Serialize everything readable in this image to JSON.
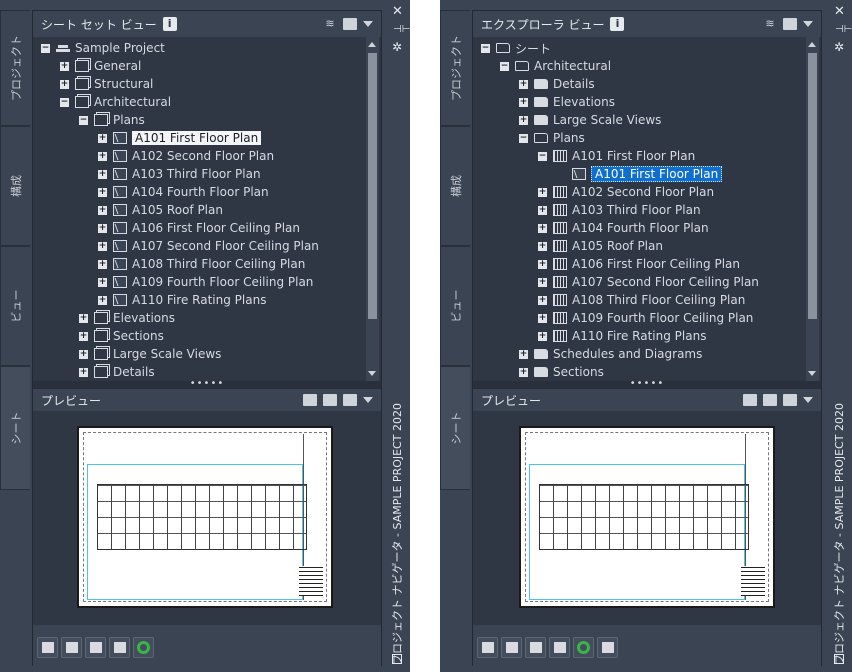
{
  "left": {
    "title": "シート セット ビュー",
    "info": "i",
    "tabs": [
      "プロジェクト",
      "構成",
      "ビュー",
      "シート"
    ],
    "tree": [
      {
        "label": "Sample Project",
        "exp": "−",
        "icon": "root",
        "lvl": 0
      },
      {
        "label": "General",
        "exp": "+",
        "icon": "stack",
        "lvl": 1
      },
      {
        "label": "Structural",
        "exp": "+",
        "icon": "stack",
        "lvl": 1
      },
      {
        "label": "Architectural",
        "exp": "−",
        "icon": "stack",
        "lvl": 1
      },
      {
        "label": "Plans",
        "exp": "−",
        "icon": "stack",
        "lvl": 2
      },
      {
        "label": "A101 First Floor Plan",
        "exp": "+",
        "icon": "sheet",
        "lvl": 3,
        "sel": "outline"
      },
      {
        "label": "A102 Second Floor Plan",
        "exp": "+",
        "icon": "sheet",
        "lvl": 3
      },
      {
        "label": "A103 Third Floor Plan",
        "exp": "+",
        "icon": "sheet",
        "lvl": 3
      },
      {
        "label": "A104 Fourth Floor Plan",
        "exp": "+",
        "icon": "sheet",
        "lvl": 3
      },
      {
        "label": "A105 Roof Plan",
        "exp": "+",
        "icon": "sheet",
        "lvl": 3
      },
      {
        "label": "A106 First Floor Ceiling Plan",
        "exp": "+",
        "icon": "sheet",
        "lvl": 3
      },
      {
        "label": "A107 Second Floor Ceiling Plan",
        "exp": "+",
        "icon": "sheet",
        "lvl": 3
      },
      {
        "label": "A108 Third Floor Ceiling Plan",
        "exp": "+",
        "icon": "sheet",
        "lvl": 3
      },
      {
        "label": "A109 Fourth Floor Ceiling Plan",
        "exp": "+",
        "icon": "sheet",
        "lvl": 3
      },
      {
        "label": "A110 Fire Rating Plans",
        "exp": "+",
        "icon": "sheet",
        "lvl": 3
      },
      {
        "label": "Elevations",
        "exp": "+",
        "icon": "stack",
        "lvl": 2
      },
      {
        "label": "Sections",
        "exp": "+",
        "icon": "stack",
        "lvl": 2
      },
      {
        "label": "Large Scale Views",
        "exp": "+",
        "icon": "stack",
        "lvl": 2
      },
      {
        "label": "Details",
        "exp": "+",
        "icon": "stack",
        "lvl": 2
      }
    ],
    "preview_label": "プレビュー",
    "side_title": "プロジェクト ナビゲータ - SAMPLE PROJECT 2020"
  },
  "right": {
    "title": "エクスプローラ ビュー",
    "info": "i",
    "tabs": [
      "プロジェクト",
      "構成",
      "ビュー",
      "シート"
    ],
    "tree": [
      {
        "label": "シート",
        "exp": "−",
        "icon": "folder-open",
        "lvl": 0
      },
      {
        "label": "Architectural",
        "exp": "−",
        "icon": "folder-open",
        "lvl": 1
      },
      {
        "label": "Details",
        "exp": "+",
        "icon": "folder",
        "lvl": 2
      },
      {
        "label": "Elevations",
        "exp": "+",
        "icon": "folder",
        "lvl": 2
      },
      {
        "label": "Large Scale Views",
        "exp": "+",
        "icon": "folder",
        "lvl": 2
      },
      {
        "label": "Plans",
        "exp": "−",
        "icon": "folder-open",
        "lvl": 2
      },
      {
        "label": "A101 First Floor Plan",
        "exp": "−",
        "icon": "dwg",
        "lvl": 3
      },
      {
        "label": "A101 First Floor Plan",
        "exp": "",
        "icon": "sheet",
        "lvl": 4,
        "sel": "blue"
      },
      {
        "label": "A102 Second Floor Plan",
        "exp": "+",
        "icon": "dwg",
        "lvl": 3
      },
      {
        "label": "A103 Third Floor Plan",
        "exp": "+",
        "icon": "dwg",
        "lvl": 3
      },
      {
        "label": "A104 Fourth Floor Plan",
        "exp": "+",
        "icon": "dwg",
        "lvl": 3
      },
      {
        "label": "A105 Roof Plan",
        "exp": "+",
        "icon": "dwg",
        "lvl": 3
      },
      {
        "label": "A106 First Floor Ceiling Plan",
        "exp": "+",
        "icon": "dwg",
        "lvl": 3
      },
      {
        "label": "A107 Second Floor Ceiling Plan",
        "exp": "+",
        "icon": "dwg",
        "lvl": 3
      },
      {
        "label": "A108 Third Floor Ceiling Plan",
        "exp": "+",
        "icon": "dwg",
        "lvl": 3
      },
      {
        "label": "A109 Fourth Floor Ceiling Plan",
        "exp": "+",
        "icon": "dwg",
        "lvl": 3
      },
      {
        "label": "A110 Fire Rating Plans",
        "exp": "+",
        "icon": "dwg",
        "lvl": 3
      },
      {
        "label": "Schedules and Diagrams",
        "exp": "+",
        "icon": "folder",
        "lvl": 2
      },
      {
        "label": "Sections",
        "exp": "+",
        "icon": "folder",
        "lvl": 2
      }
    ],
    "preview_label": "プレビュー",
    "side_title": "プロジェクト ナビゲータ - SAMPLE PROJECT 2020"
  },
  "colors": {
    "panel_bg": "#2f3644",
    "chrome_bg": "#3b4453",
    "selection_blue": "#0f6fd1",
    "refresh_green": "#39b54a"
  },
  "icons": {
    "close": "close-icon",
    "pin": "auto-hide-icon",
    "settings": "gear-icon",
    "info": "info-icon"
  }
}
